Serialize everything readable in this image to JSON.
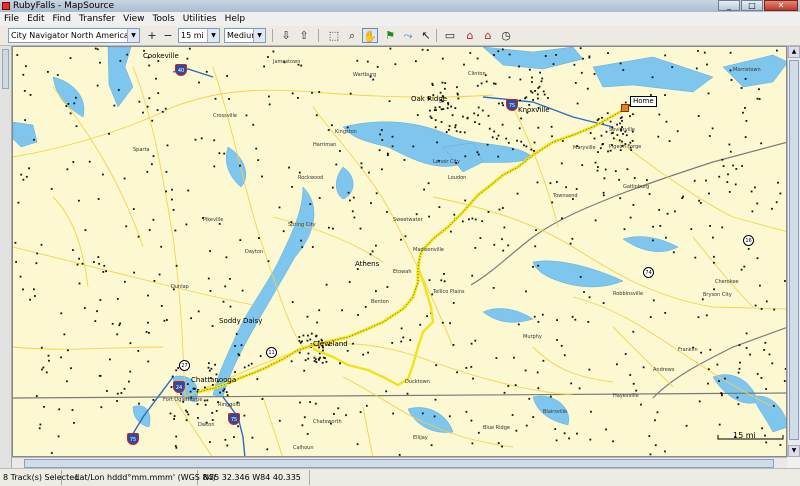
{
  "window": {
    "title": "RubyFalls - MapSource",
    "minimize": "_",
    "maximize": "□",
    "close": "✕"
  },
  "menu": [
    "File",
    "Edit",
    "Find",
    "Transfer",
    "View",
    "Tools",
    "Utilities",
    "Help"
  ],
  "toolbar": {
    "map_product": "City Navigator North America NT 2009",
    "zoom_in": "+",
    "zoom_out": "−",
    "zoom_level": "15 mi",
    "detail_level": "Medium",
    "icons": [
      "zoom-in-icon",
      "zoom-out-icon",
      "receive-from-device-icon",
      "send-to-device-icon",
      "select-tool-icon",
      "zoom-tool-icon",
      "hand-tool-icon",
      "waypoint-tool-icon",
      "route-tool-icon",
      "pointer-tool-icon",
      "measure-tool-icon",
      "find-places-icon",
      "find-home-icon",
      "recent-finds-icon"
    ]
  },
  "map": {
    "home_label": "Home",
    "scale_label": "15 mi",
    "route_color": "#f2e21c",
    "water_color": "#7fc6ee",
    "land_color": "#fbf8d2",
    "road_color": "#f5d142",
    "interstate_shields": [
      "40",
      "75",
      "24",
      "75"
    ],
    "us_shields": [
      "27",
      "11",
      "74",
      "16"
    ],
    "places": [
      {
        "name": "Cookeville"
      },
      {
        "name": "Oak Ridge"
      },
      {
        "name": "Knoxville"
      },
      {
        "name": "Clinton"
      },
      {
        "name": "Lenoir City"
      },
      {
        "name": "Maryville"
      },
      {
        "name": "Sevierville"
      },
      {
        "name": "Pigeon Forge"
      },
      {
        "name": "Gatlinburg"
      },
      {
        "name": "Athens"
      },
      {
        "name": "Cleveland"
      },
      {
        "name": "Chattanooga"
      },
      {
        "name": "Soddy Daisy"
      },
      {
        "name": "Harriman"
      },
      {
        "name": "Kingston"
      },
      {
        "name": "Crossville"
      },
      {
        "name": "Madisonville"
      },
      {
        "name": "Tellico Plains"
      },
      {
        "name": "Etowah"
      },
      {
        "name": "Dayton"
      },
      {
        "name": "Spring City"
      },
      {
        "name": "Morristown"
      },
      {
        "name": "Townsend"
      },
      {
        "name": "Murphy"
      },
      {
        "name": "Dalton"
      },
      {
        "name": "Ringgold"
      },
      {
        "name": "Ducktown"
      },
      {
        "name": "Benton"
      },
      {
        "name": "Sweetwater"
      },
      {
        "name": "Loudon"
      },
      {
        "name": "Rockwood"
      },
      {
        "name": "Dunlap"
      },
      {
        "name": "Pikeville"
      },
      {
        "name": "Sparta"
      },
      {
        "name": "Jamestown"
      },
      {
        "name": "Wartburg"
      },
      {
        "name": "Robbinsville"
      },
      {
        "name": "Bryson City"
      },
      {
        "name": "Cherokee"
      },
      {
        "name": "Franklin"
      },
      {
        "name": "Blue Ridge"
      },
      {
        "name": "Blairsville"
      },
      {
        "name": "Hayesville"
      },
      {
        "name": "Andrews"
      },
      {
        "name": "Ellijay"
      },
      {
        "name": "Chatsworth"
      },
      {
        "name": "Calhoun"
      },
      {
        "name": "Fort Oglethorpe"
      }
    ]
  },
  "status": {
    "tracks_selected": "8 Track(s) Selected",
    "coord_format": "Lat/Lon hddd°mm.mmm' (WGS 84)",
    "position": "N35 32.346 W84 40.335"
  }
}
